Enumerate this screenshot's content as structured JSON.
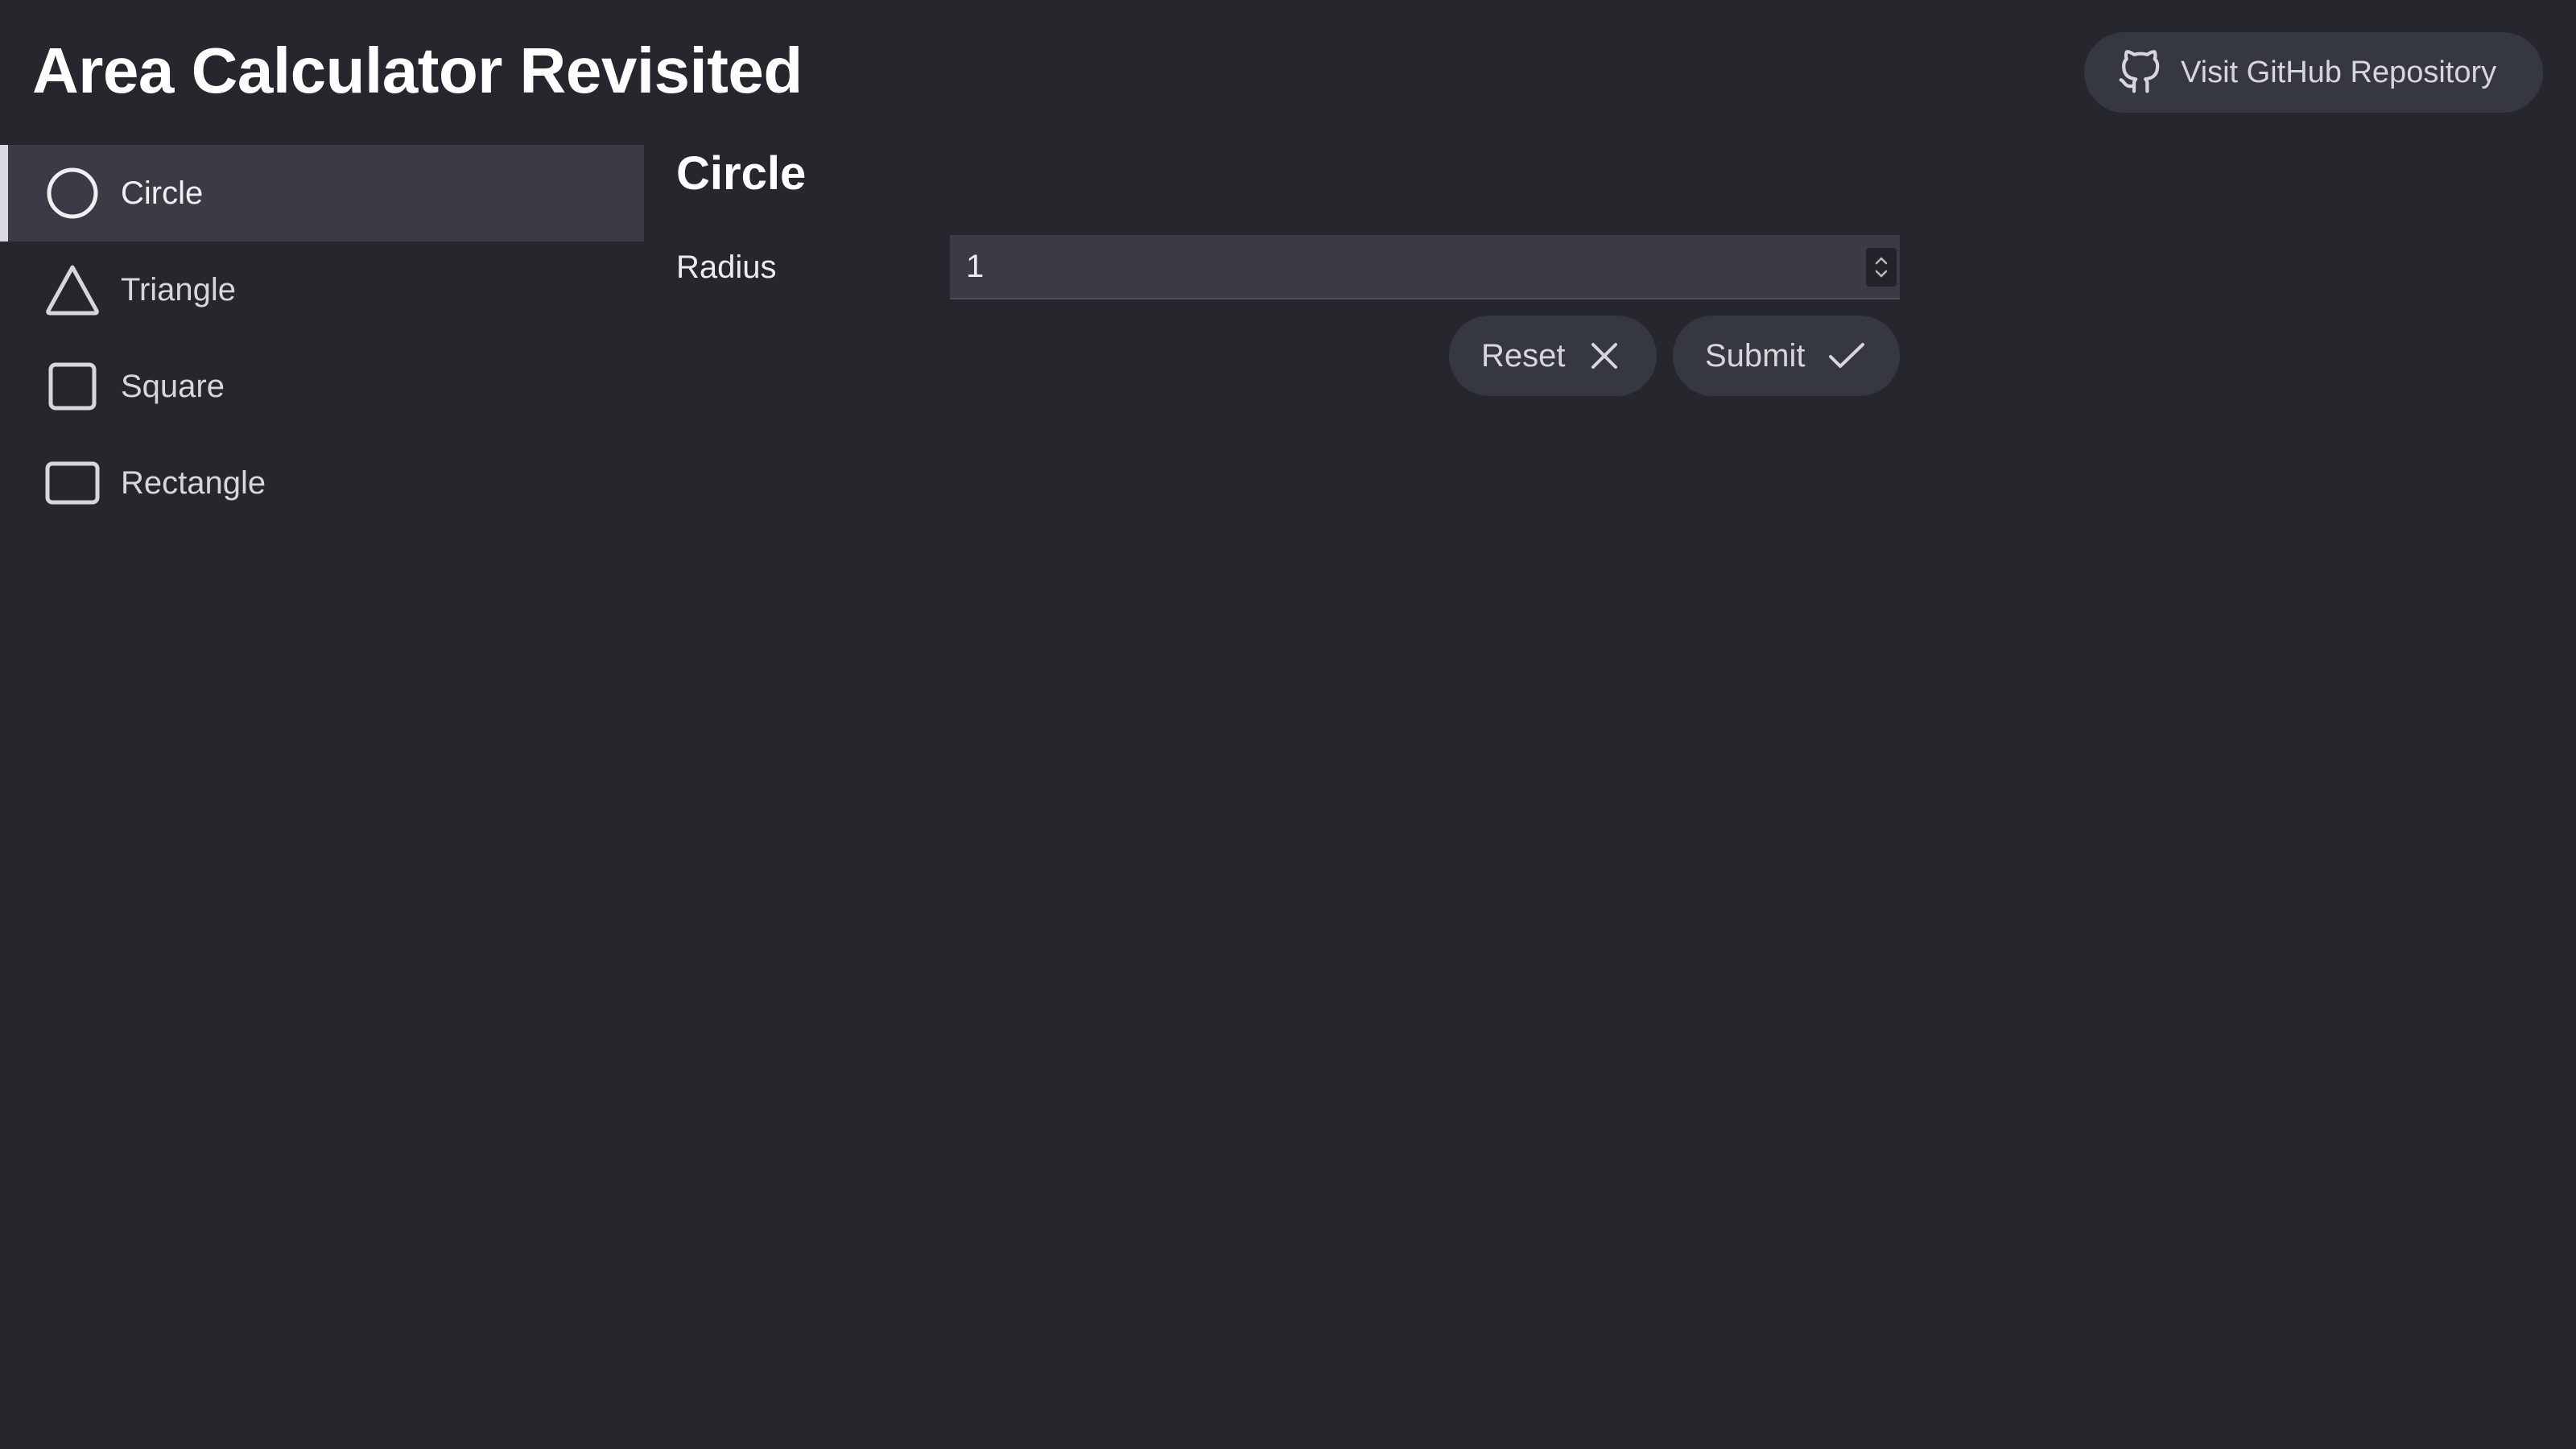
{
  "header": {
    "title": "Area Calculator Revisited",
    "github_button": {
      "label": "Visit GitHub Repository",
      "icon": "github-icon"
    }
  },
  "sidebar": {
    "items": [
      {
        "label": "Circle",
        "icon": "circle-icon",
        "active": true
      },
      {
        "label": "Triangle",
        "icon": "triangle-icon",
        "active": false
      },
      {
        "label": "Square",
        "icon": "square-icon",
        "active": false
      },
      {
        "label": "Rectangle",
        "icon": "rectangle-icon",
        "active": false
      }
    ]
  },
  "main": {
    "section_title": "Circle",
    "fields": [
      {
        "label": "Radius",
        "value": "1",
        "type": "number"
      }
    ],
    "buttons": {
      "reset": {
        "label": "Reset",
        "icon": "close-icon"
      },
      "submit": {
        "label": "Submit",
        "icon": "check-icon"
      }
    }
  },
  "colors": {
    "background": "#26272c",
    "surface": "#363841",
    "active_item": "#3a3b45",
    "text": "#ececef",
    "active_indicator": "#d8d9de"
  }
}
